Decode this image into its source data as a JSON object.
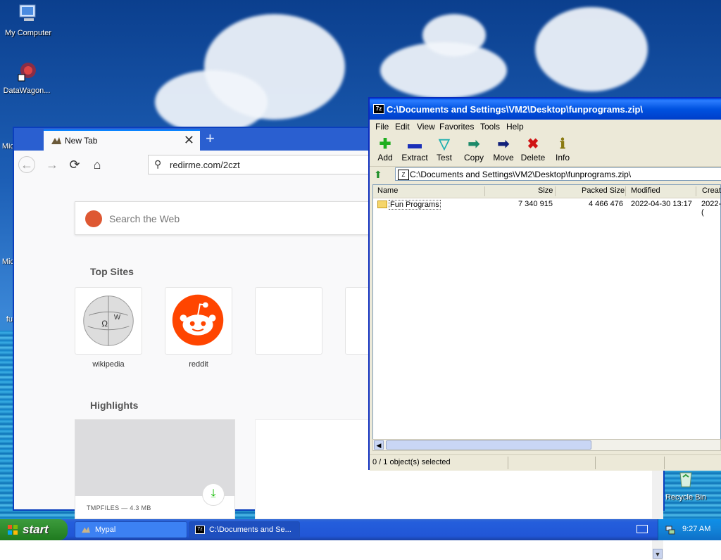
{
  "desktop": {
    "icons": [
      {
        "label": "My Computer"
      },
      {
        "label": "DataWagon..."
      },
      {
        "label": "Mic"
      },
      {
        "label": "Mic"
      },
      {
        "label": "fu"
      },
      {
        "label": "Recycle Bin"
      }
    ]
  },
  "browser": {
    "tab_title": "New Tab",
    "tab_close": "✕",
    "new_tab": "+",
    "url": "redirme.com/2czt",
    "search_placeholder": "Search the Web",
    "top_sites_title": "Top Sites",
    "top_sites": [
      {
        "label": "wikipedia"
      },
      {
        "label": "reddit"
      }
    ],
    "highlights_title": "Highlights",
    "highlight_caption": "TMPFILES — 4.3 MB"
  },
  "sevenzip": {
    "title": "C:\\Documents and Settings\\VM2\\Desktop\\funprograms.zip\\",
    "menu": [
      "File",
      "Edit",
      "View",
      "Favorites",
      "Tools",
      "Help"
    ],
    "toolbar": [
      {
        "label": "Add",
        "icon": "plus-icon"
      },
      {
        "label": "Extract",
        "icon": "minus-icon"
      },
      {
        "label": "Test",
        "icon": "check-icon"
      },
      {
        "label": "Copy",
        "icon": "copy-arrow-icon"
      },
      {
        "label": "Move",
        "icon": "move-arrow-icon"
      },
      {
        "label": "Delete",
        "icon": "delete-x-icon"
      },
      {
        "label": "Info",
        "icon": "info-icon"
      }
    ],
    "path": "C:\\Documents and Settings\\VM2\\Desktop\\funprograms.zip\\",
    "columns": [
      "Name",
      "Size",
      "Packed Size",
      "Modified",
      "Creat"
    ],
    "rows": [
      {
        "name": "Fun Programs",
        "size": "7 340 915",
        "packed": "4 466 476",
        "modified": "2022-04-30 13:17",
        "created": "2022-("
      }
    ],
    "status": "0 / 1 object(s) selected"
  },
  "taskbar": {
    "start_label": "start",
    "items": [
      {
        "label": "Mypal"
      },
      {
        "label": "C:\\Documents and Se..."
      }
    ],
    "clock": "9:27 AM"
  },
  "colors": {
    "xp_blue": "#245edc",
    "start_green": "#2e8b2e",
    "firefox_accent": "#0a84ff"
  }
}
